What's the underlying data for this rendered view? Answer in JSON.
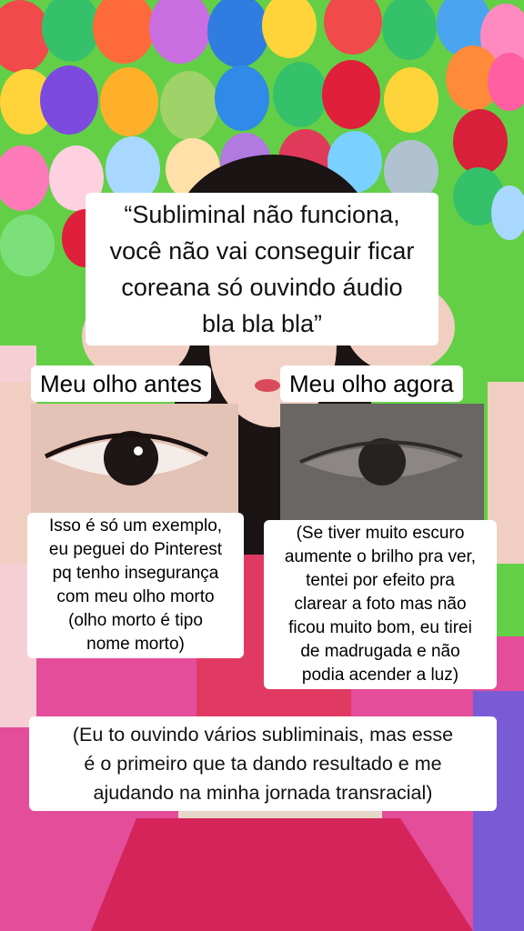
{
  "main_caption": {
    "lines": [
      "“Subliminal não funciona,",
      "você não vai conseguir ficar",
      "coreana só ouvindo áudio",
      "bla bla bla”"
    ]
  },
  "before": {
    "label": "Meu olho antes",
    "note_lines": [
      "Isso é só um exemplo,",
      "eu peguei do Pinterest",
      "pq tenho insegurança",
      "com meu olho morto",
      "(olho morto é tipo",
      "nome morto)"
    ]
  },
  "after": {
    "label": "Meu olho agora",
    "note_lines": [
      "(Se tiver muito escuro",
      "aumente o brilho pra ver,",
      "tentei por efeito pra",
      "clarear a foto mas não",
      "ficou muito bom, eu tirei",
      "de madrugada e não",
      "podia acender a luz)"
    ]
  },
  "bottom_caption": {
    "lines": [
      "(Eu to ouvindo vários subliminais, mas esse",
      "é o primeiro que ta dando resultado e me",
      "ajudando na minha jornada transracial)"
    ]
  },
  "colors": {
    "wall_green": "#6ad64a",
    "top_dress": "#e03a62",
    "skirt": "#d4245a",
    "caption_bg": "#ffffff"
  }
}
